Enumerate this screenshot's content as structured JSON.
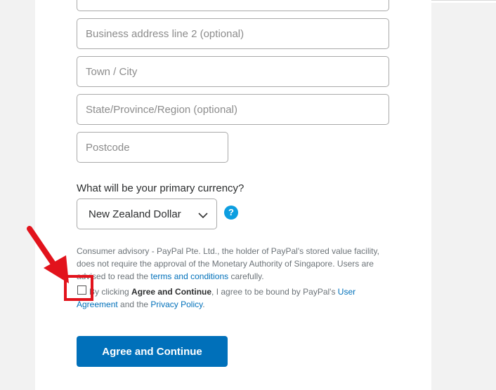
{
  "form": {
    "address_line2_placeholder": "Business address line 2 (optional)",
    "town_placeholder": "Town / City",
    "state_placeholder": "State/Province/Region (optional)",
    "postcode_placeholder": "Postcode",
    "currency_label": "What will be your primary currency?",
    "currency_value": "New Zealand Dollar",
    "help_glyph": "?"
  },
  "advisory": {
    "text_before_link": "Consumer advisory - PayPal Pte. Ltd., the holder of PayPal's stored value facility, does not require the approval of the Monetary Authority of Singapore. Users are advised to read the ",
    "link_text": "terms and conditions",
    "text_after_link": " carefully."
  },
  "agreement": {
    "text_1": "By clicking ",
    "bold_text": "Agree and Continue",
    "text_2": ", I agree to be bound by PayPal's ",
    "user_agreement_link": "User Agreement",
    "text_3": " and the ",
    "privacy_link": "Privacy Policy",
    "text_4": ".",
    "checked": false
  },
  "actions": {
    "submit_label": "Agree and Continue"
  },
  "colors": {
    "accent": "#0070ba",
    "help_icon": "#0d9ee0",
    "annotation_red": "#e2131c"
  },
  "icons": {
    "dropdown": "chevron-down-icon",
    "help": "help-icon",
    "annotation": "red-arrow-icon"
  }
}
